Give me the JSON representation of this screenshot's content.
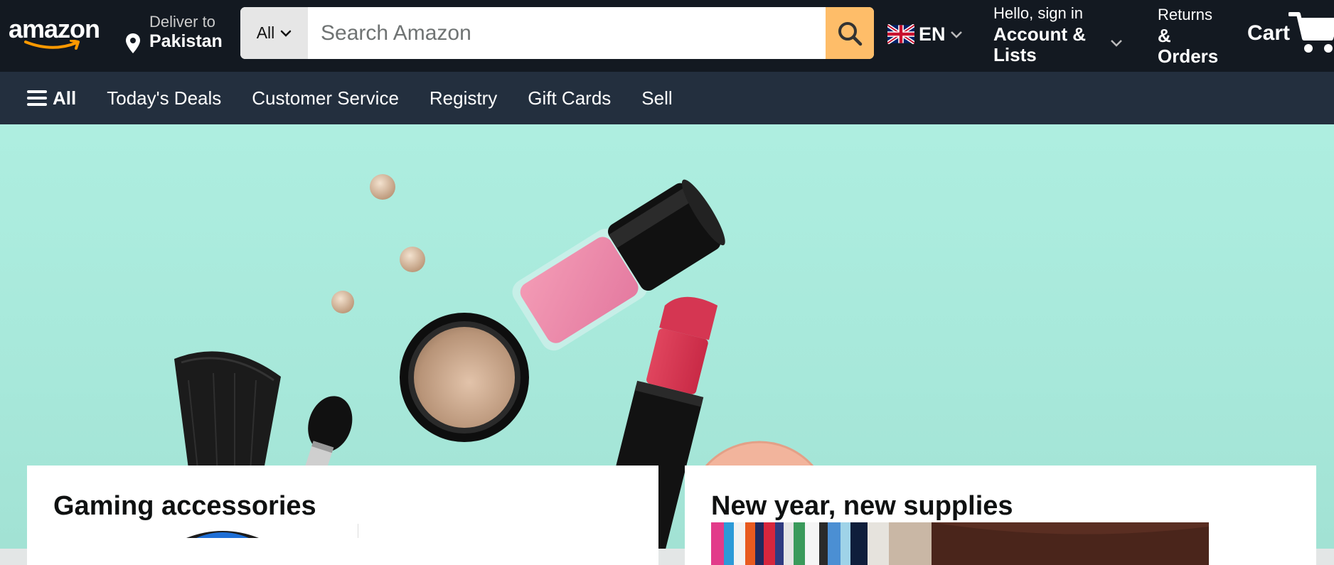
{
  "header": {
    "logo": {
      "text": "amazon",
      "icon": "amazon-smile-arrow"
    },
    "deliver": {
      "line1": "Deliver to",
      "line2": "Pakistan",
      "icon": "location-pin-icon"
    },
    "search": {
      "category": "All",
      "placeholder": "Search Amazon",
      "icon": "search-icon"
    },
    "language": {
      "code": "EN",
      "icon": "uk-flag-icon"
    },
    "account": {
      "hello": "Hello, sign in",
      "main": "Account & Lists"
    },
    "returns": {
      "line1": "Returns",
      "line2": "& Orders"
    },
    "cart": {
      "label": "Cart",
      "icon": "cart-icon"
    }
  },
  "nav": {
    "all_label": "All",
    "items": [
      "Today's Deals",
      "Customer Service",
      "Registry",
      "Gift Cards",
      "Sell"
    ]
  },
  "hero": {
    "theme": "beauty-cosmetics-banner"
  },
  "cards": [
    {
      "title": "Gaming accessories"
    },
    {
      "title": "New year, new supplies"
    }
  ],
  "colors": {
    "header_bg": "#131921",
    "nav_bg": "#232f3e",
    "search_button": "#febd69",
    "logo_arrow": "#ff9900",
    "hero_bg": "#aeeee0"
  }
}
